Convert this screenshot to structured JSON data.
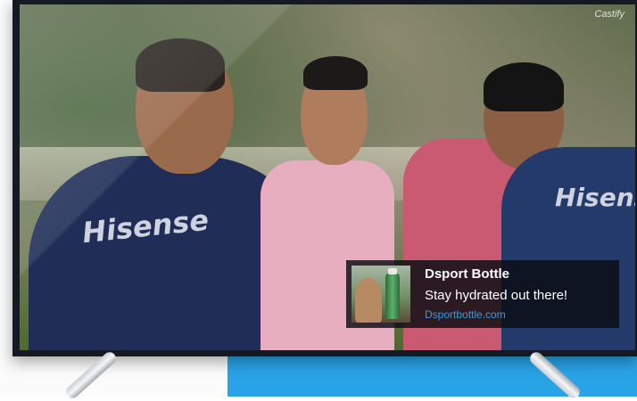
{
  "video": {
    "watermark_brand": "Castify",
    "shirt_brand": "Hisense"
  },
  "notification": {
    "title": "Dsport Bottle",
    "message": "Stay hydrated out there!",
    "link": "Dsportbottle.com"
  },
  "colors": {
    "background_right": "#28a3e6",
    "link": "#2e9ee6"
  }
}
